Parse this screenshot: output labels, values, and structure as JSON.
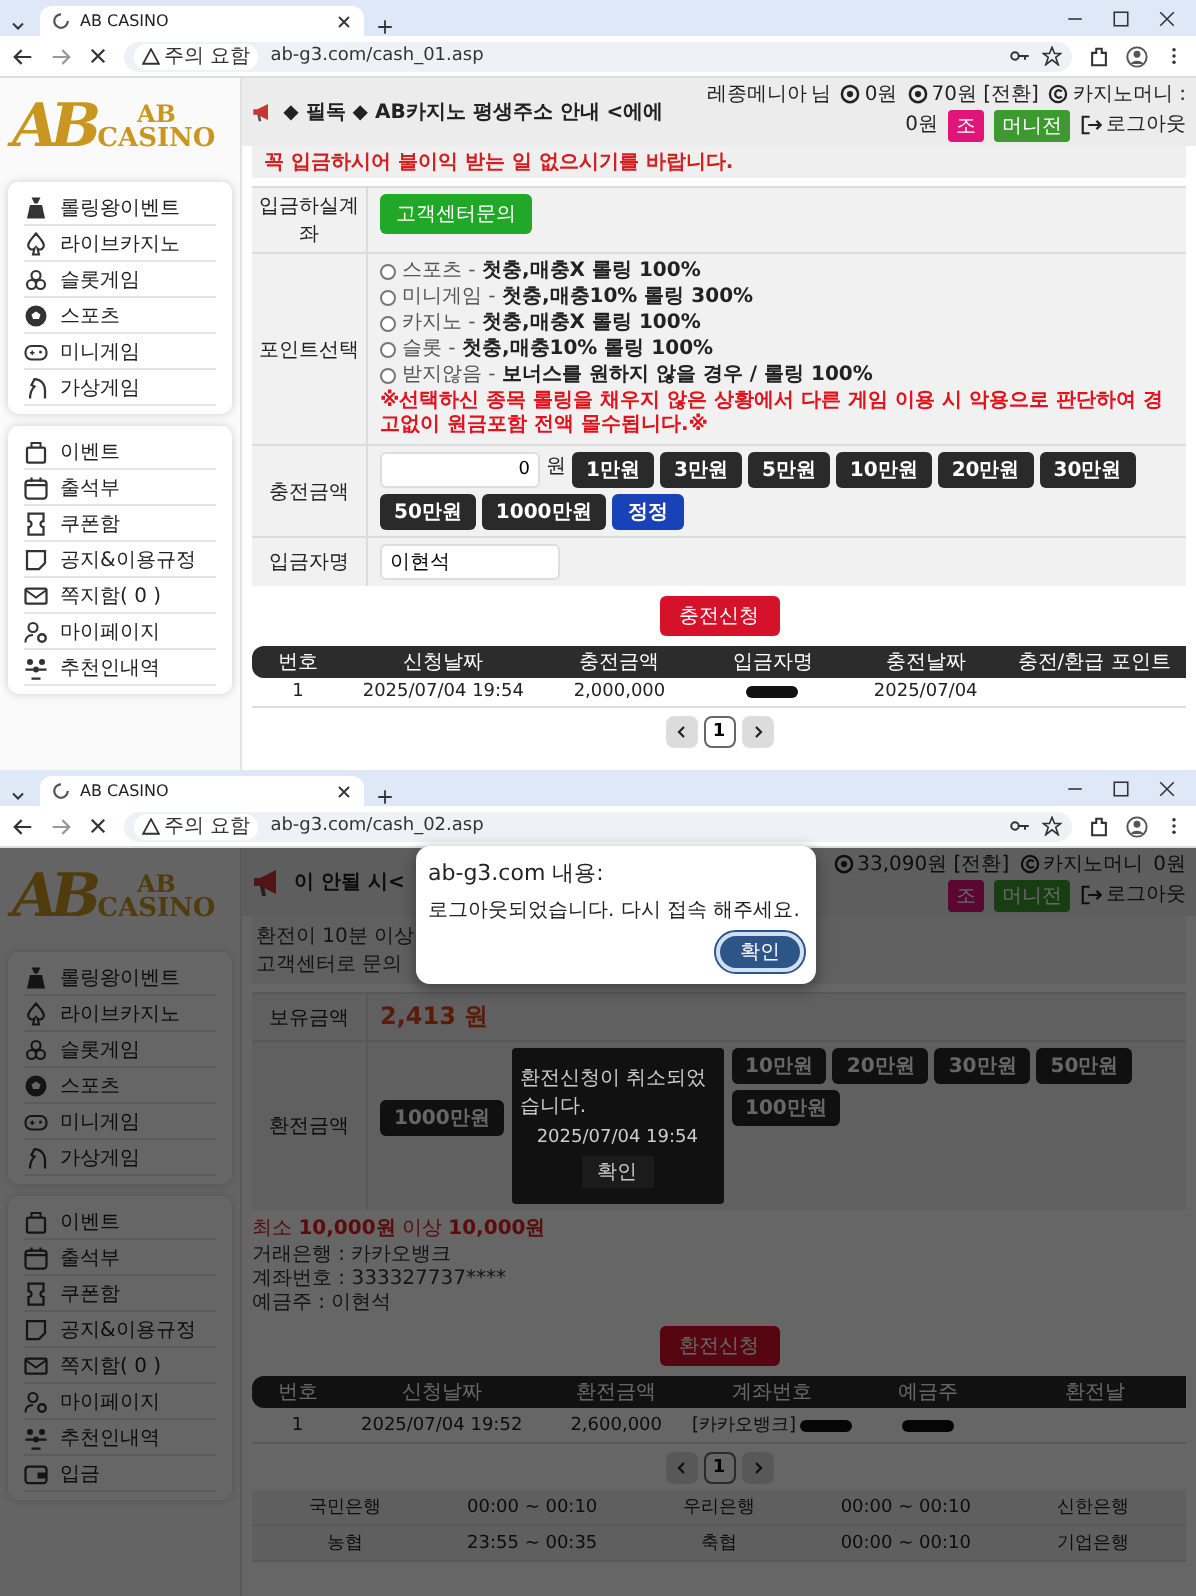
{
  "top_window": {
    "tab_title": "AB CASINO",
    "security_label": "주의 요함",
    "url": "ab-g3.com/cash_01.asp",
    "logo": {
      "monogram": "AB",
      "name_top": "AB",
      "name_bottom": "CASINO"
    },
    "sidebar": {
      "games": [
        "롤링왕이벤트",
        "라이브카지노",
        "슬롯게임",
        "스포츠",
        "미니게임",
        "가상게임"
      ],
      "menu": [
        "이벤트",
        "출석부",
        "쿠폰함",
        "공지&이용규정",
        "쪽지함( 0 )",
        "마이페이지",
        "추천인내역"
      ]
    },
    "header": {
      "marquee": "◆ 필독 ◆ AB카지노 평생주소 안내 <에에",
      "user": "레종메니아",
      "user_suffix": "님",
      "points": "0원",
      "money": "70원 [전환]",
      "casino_label": "카지노머니 :",
      "casino_value": "0원",
      "badges": [
        {
          "text": "조",
          "kind": "rank"
        },
        {
          "text": "머니전",
          "kind": "exchange"
        }
      ],
      "logout": "로그아웃"
    },
    "notice": "꼭 입금하시어 불이익 받는 일 없으시기를 바랍니다.",
    "account_row": {
      "label": "입금하실계좌",
      "button": "고객센터문의"
    },
    "point_row": {
      "label": "포인트선택",
      "options": [
        {
          "text": "스포츠 - **첫충,매충X 롤링 100%**",
          "selected": false
        },
        {
          "text": "미니게임 - **첫충,매충10% 롤링 300%**",
          "selected": false
        },
        {
          "text": "카지노 - **첫충,매충X 롤링 100%**",
          "selected": false
        },
        {
          "text": "슬롯 - **첫충,매충10% 롤링 100%**",
          "selected": false
        },
        {
          "text": "받지않음 - **보너스를 원하지 않을 경우 / 롤링 100%**",
          "selected": false
        }
      ],
      "warning": "※선택하신 종목 롤링을 채우지 않은 상황에서 다른 게임 이용 시 악용으로 판단하여 경고없이 원금포함 전액 몰수됩니다.※"
    },
    "amount_row": {
      "label": "충전금액",
      "value": "0",
      "unit": "원",
      "buttons": [
        "1만원",
        "3만원",
        "5만원",
        "10만원",
        "20만원",
        "30만원",
        "50만원",
        "1000만원"
      ],
      "reset": "정정"
    },
    "name_row": {
      "label": "입금자명",
      "value": "이현석"
    },
    "submit": "충전신청",
    "table": {
      "columns": [
        "번호",
        "신청날짜",
        "충전금액",
        "입금자명",
        "충전날짜",
        "충전/환급 포인트"
      ],
      "rows": [
        {
          "cells": [
            {
              "text": "1"
            },
            {
              "text": "2025/07/04 19:54"
            },
            {
              "text": "2,000,000"
            },
            {
              "redacted": true
            },
            {
              "text": "2025/07/04"
            }
          ]
        }
      ]
    },
    "pager": [
      {
        "label": "1",
        "selected": true
      }
    ]
  },
  "bottom_window": {
    "tab_title": "AB CASINO",
    "security_label": "주의 요함",
    "url": "ab-g3.com/cash_02.asp",
    "logo": {
      "monogram": "AB",
      "name_top": "AB",
      "name_bottom": "CASINO"
    },
    "sidebar": {
      "games": [
        "롤링왕이벤트",
        "라이브카지노",
        "슬롯게임",
        "스포츠",
        "미니게임",
        "가상게임"
      ],
      "menu": [
        "이벤트",
        "출석부",
        "쿠폰함",
        "공지&이용규정",
        "쪽지함( 0 )",
        "마이페이지",
        "추천인내역",
        "입금"
      ]
    },
    "header": {
      "marquee": "이 안될 시<",
      "money": "33,090원 [전환]",
      "casino_label": "카지노머니",
      "casino_value": "0원",
      "badges": [
        {
          "text": "조",
          "kind": "rank"
        },
        {
          "text": "머니전",
          "kind": "exchange"
        }
      ],
      "logout": "로그아웃"
    },
    "notice_lines": [
      "환전이 10분 이상",
      "고객센터로 문의"
    ],
    "balance_row": {
      "label": "보유금액",
      "value": "2,413 원"
    },
    "amount_row": {
      "label": "환전금액",
      "buttons": [
        "10만원",
        "20만원",
        "30만원",
        "50만원",
        "100만원"
      ],
      "big_button": "1000만원"
    },
    "limits": "최소 **10,000원** 이상 **10,000원**",
    "bank_info": [
      "거래은행 : 카카오뱅크",
      "계좌번호 : 333327737****",
      "예금주 : 이현석"
    ],
    "submit": "환전신청",
    "table": {
      "columns": [
        "번호",
        "신청날짜",
        "환전금액",
        "계좌번호",
        "예금주",
        "환전날"
      ],
      "rows": [
        {
          "cells": [
            {
              "text": "1"
            },
            {
              "text": "2025/07/04 19:52"
            },
            {
              "text": "2,600,000"
            },
            {
              "text": "[카카오뱅크]",
              "redacted": true
            },
            {
              "redacted": true
            }
          ]
        }
      ]
    },
    "pager": [
      {
        "label": "1",
        "selected": true
      }
    ],
    "bank_hours": [
      [
        "국민은행",
        "00:00 ~ 00:10",
        "우리은행",
        "00:00 ~ 00:10",
        "신한은행"
      ],
      [
        "농협",
        "23:55 ~ 00:35",
        "축협",
        "00:00 ~ 00:10",
        "기업은행"
      ]
    ],
    "modal": {
      "message": "환전신청이 취소되었습니다.",
      "time": "2025/07/04 19:54",
      "button": "확인"
    },
    "alert": {
      "title": "ab-g3.com 내용:",
      "message": "로그아웃되었습니다.  다시 접속 해주세요.",
      "button": "확인"
    }
  }
}
